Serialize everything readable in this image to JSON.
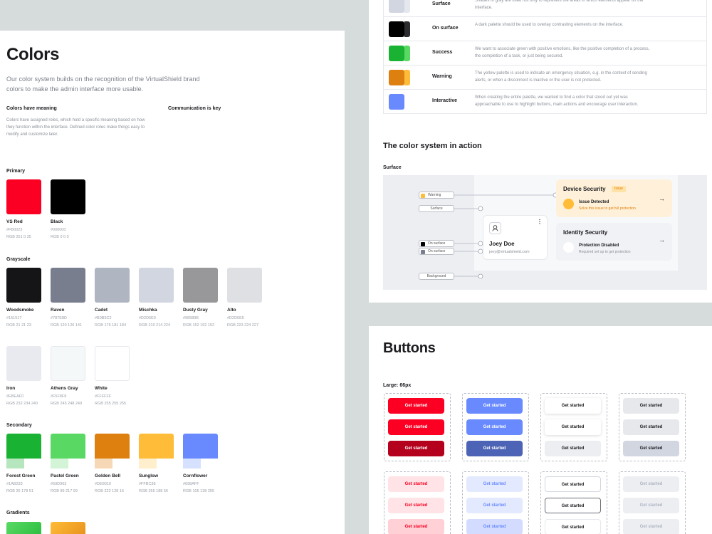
{
  "colors_page": {
    "title": "Colors",
    "intro": "Our color system builds on the recognition of the VirtualShield brand colors to make the admin interface more usable.",
    "meaning_title": "Colors have meaning",
    "meaning_text": "Colors have assigned roles, which hold a specific meaning based on how they function within the interface. Defined color roles make things easy to modify and customize later.",
    "key_title": "Communication is key",
    "primary_label": "Primary",
    "primary": [
      {
        "name": "VS Red",
        "hex": "#FB0023",
        "rgb": "RGB 251 0 35",
        "color": "#fb0023"
      },
      {
        "name": "Black",
        "hex": "#000000",
        "rgb": "RGB 0 0 0",
        "color": "#000000"
      }
    ],
    "grayscale_label": "Grayscale",
    "grayscale": [
      {
        "name": "Woodsmoke",
        "hex": "#151517",
        "rgb": "RGB 21 21 23",
        "color": "#151517"
      },
      {
        "name": "Raven",
        "hex": "#787E8D",
        "rgb": "RGB 120 126 141",
        "color": "#787e8d"
      },
      {
        "name": "Cadet",
        "hex": "#B0B5C2",
        "rgb": "RGB 176 181 184",
        "color": "#b0b5c2"
      },
      {
        "name": "Mischka",
        "hex": "#D2D6E0",
        "rgb": "RGB 210 214 224",
        "color": "#d2d6e0"
      },
      {
        "name": "Dusty Gray",
        "hex": "#98989B",
        "rgb": "RGB 152 152 152",
        "color": "#98989b"
      },
      {
        "name": "Alto",
        "hex": "#D2D6E5",
        "rgb": "RGB 223 224 227",
        "color": "#dfe0e3"
      },
      {
        "name": "Iron",
        "hex": "#EBEAF0",
        "rgb": "RGB 232 234 240",
        "color": "#e8eaf0"
      },
      {
        "name": "Athens Gray",
        "hex": "#F5F8F8",
        "rgb": "RGB 245 248 249",
        "color": "#f5f8f9"
      },
      {
        "name": "White",
        "hex": "#FFFFFF",
        "rgb": "RGB 255 255 255",
        "color": "#ffffff"
      }
    ],
    "secondary_label": "Secondary",
    "secondary": [
      {
        "name": "Forest Green",
        "hex": "#1AB233",
        "rgb": "RGB 26 178 51",
        "color": "#1ab233",
        "tint": "#b6e6be"
      },
      {
        "name": "Pastel Green",
        "hex": "#59D963",
        "rgb": "RGB 89 217 99",
        "color": "#59d963",
        "tint": "#d3f4d6"
      },
      {
        "name": "Golden Bell",
        "hex": "#DE8010",
        "rgb": "RGB 222 128 16",
        "color": "#de8010",
        "tint": "#f6d8b6"
      },
      {
        "name": "Sunglow",
        "hex": "#FFBC38",
        "rgb": "RGB 255 188 56",
        "color": "#ffbc38",
        "tint": "#ffefcd"
      },
      {
        "name": "Cornflower",
        "hex": "#698AFF",
        "rgb": "RGB 105 138 255",
        "color": "#698aff",
        "tint": "#d6e0ff"
      }
    ],
    "gradients_label": "Gradients"
  },
  "roles_table": [
    {
      "name": "Surface",
      "desc": "Shades of gray are used not only to represent the areas in which elements appear on the interface.",
      "colors": [
        "#d2d6e0",
        "#e4e7ee"
      ]
    },
    {
      "name": "On surface",
      "desc": "A dark palette should be used to overlay contrasting elements on the interface.",
      "colors": [
        "#000000",
        "#2b2b30"
      ]
    },
    {
      "name": "Success",
      "desc": "We want to associate green with positive emotions, like the positive completion of a process, the completion of a task, or just being secured.",
      "colors": [
        "#1ab233",
        "#59d963"
      ]
    },
    {
      "name": "Warning",
      "desc": "The yellow palette is used to indicate an emergency situation, e.g. in the context of sending alerts, or when a disconnect is inactive or the user is not protected.",
      "colors": [
        "#de8010",
        "#ffbc38"
      ]
    },
    {
      "name": "Interactive",
      "desc": "When creating the entire palette, we wanted to find a color that stood out yet was approachable to use to highlight buttons, main actions and encourage user interaction.",
      "colors": [
        "#698aff",
        "#698aff"
      ]
    }
  ],
  "action": {
    "title": "The color system in action",
    "surface_label": "Surface",
    "pills": {
      "warning": "Warning",
      "surface": "Surface",
      "on_surface_1": "On surface",
      "on_surface_2": "On surface",
      "background": "Background"
    },
    "user_name": "Joey Doe",
    "user_email": "joey@virtualshield.com",
    "device_title": "Device Security",
    "device_badge": "Issue",
    "issue_title": "Issue Detected",
    "issue_sub": "Solve this issue to get full protection",
    "identity_title": "Identity Security",
    "identity_status": "Protection Disabled",
    "identity_sub": "Required set up to get protection"
  },
  "buttons_page": {
    "title": "Buttons",
    "size_label": "Large: 66px",
    "button_label": "Get started"
  }
}
